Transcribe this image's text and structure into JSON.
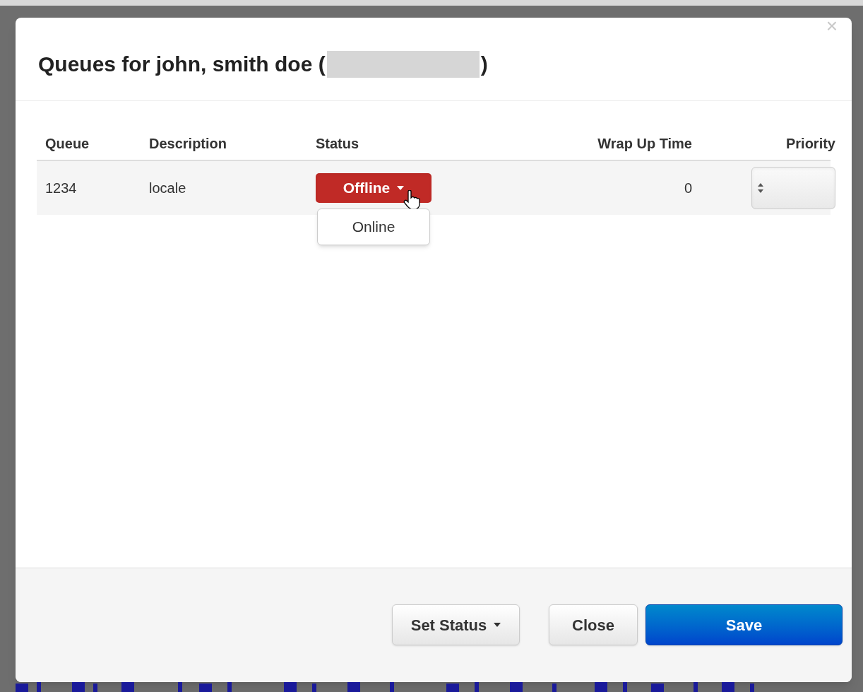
{
  "dialog": {
    "title": "Queues for john, smith doe (",
    "title_end": ")",
    "close": "×"
  },
  "table": {
    "columns": [
      "Queue",
      "Description",
      "Status",
      "Wrap Up Time",
      "Priority"
    ],
    "rows": [
      {
        "queue": "1234",
        "description": "locale",
        "status": {
          "label": "Offline",
          "expanded": true,
          "options": [
            "Online"
          ]
        },
        "wrap_up_time": "0"
      }
    ]
  },
  "footer": {
    "buttons": [
      {
        "label": "Set Status",
        "kind": "dropdown"
      },
      {
        "label": "Close",
        "kind": "default"
      },
      {
        "label": "Save",
        "kind": "primary"
      }
    ]
  }
}
